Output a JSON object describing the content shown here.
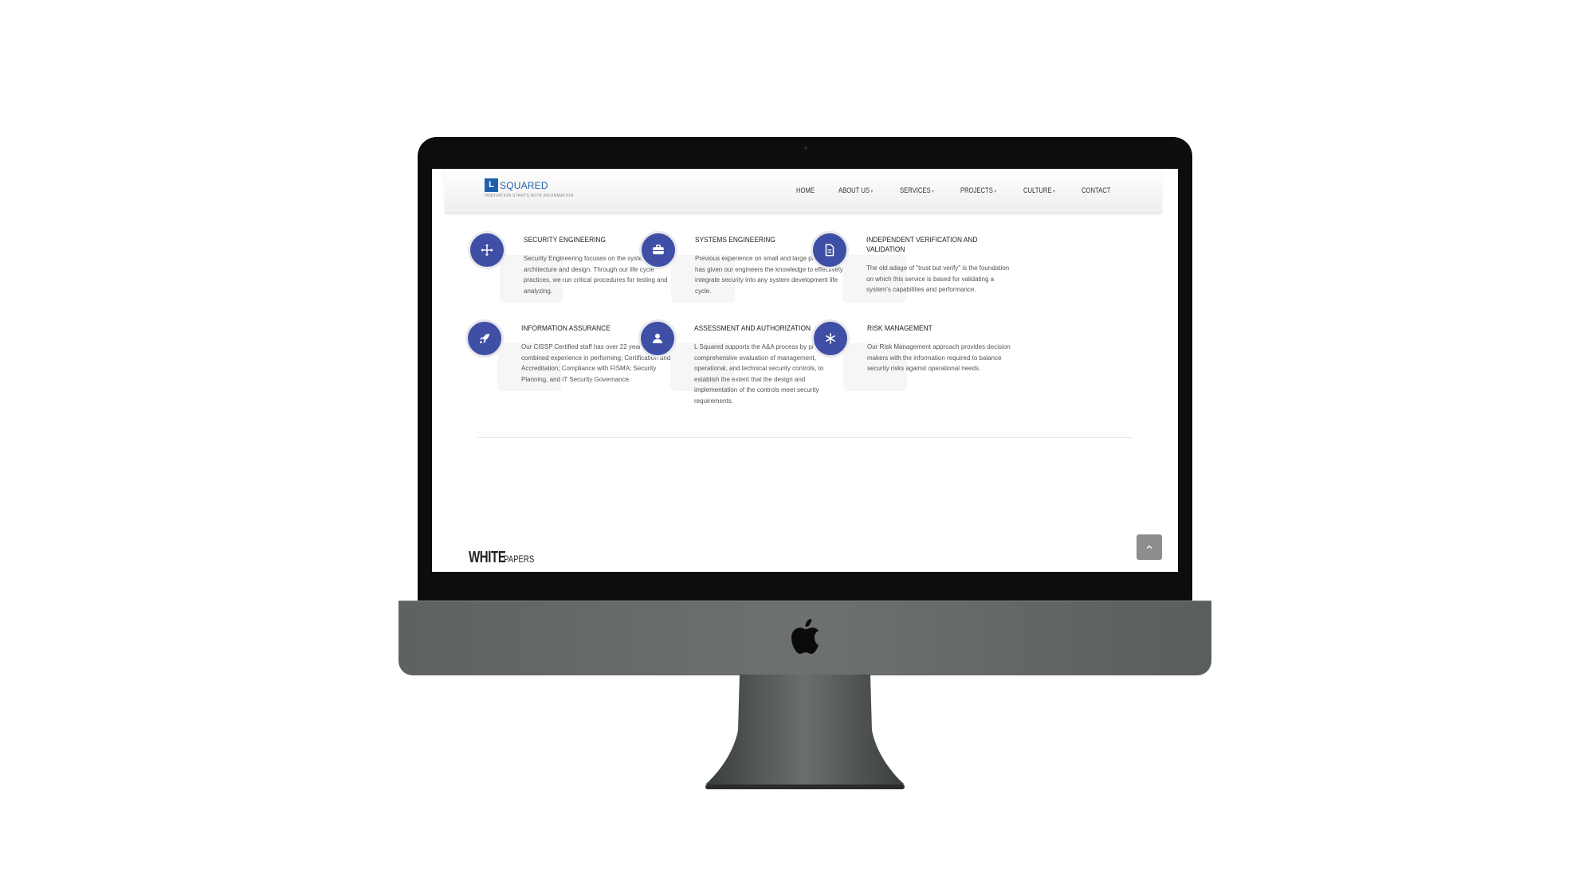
{
  "site": {
    "logo_letter": "L",
    "logo_name": "SQUARED",
    "logo_tagline": "INNOVATION STARTS WITH INFORMATION"
  },
  "nav": {
    "items": [
      {
        "label": "HOME",
        "dropdown": false
      },
      {
        "label": "ABOUT US",
        "dropdown": true
      },
      {
        "label": "SERVICES",
        "dropdown": true
      },
      {
        "label": "PROJECTS",
        "dropdown": true
      },
      {
        "label": "CULTURE",
        "dropdown": true
      },
      {
        "label": "CONTACT",
        "dropdown": false
      }
    ]
  },
  "services": [
    {
      "title": "SECURITY ENGINEERING",
      "icon": "move-arrows-icon",
      "text": "Security Engineering focuses on the system architecture and design. Through our life cycle practices, we run critical procedures for testing and analyzing."
    },
    {
      "title": "SYSTEMS ENGINEERING",
      "icon": "briefcase-icon",
      "text": "Previous experience on small and large programs has given our engineers the knowledge to effectively integrate security into any system development life cycle."
    },
    {
      "title": "INDEPENDENT VERIFICATION AND VALIDATION",
      "icon": "document-icon",
      "text": "The old adage of \"trust but verify\" is the foundation on which this service is based for validating a system's capabilities and performance."
    },
    {
      "title": "INFORMATION ASSURANCE",
      "icon": "rocket-icon",
      "text": "Our CISSP Certified staff has over 22 years of combined experience in performing; Certification and Accreditation; Compliance with FISMA; Security Planning, and IT Security Governance."
    },
    {
      "title": "ASSESSMENT AND AUTHORIZATION",
      "icon": "user-icon",
      "text": "L Squared supports the A&A process by providing comprehensive evaluation of management, operational, and technical security controls, to establish the extent that the design and implementation of the controls meet security requirements."
    },
    {
      "title": "RISK MANAGEMENT",
      "icon": "asterisk-icon",
      "text": "Our Risk Management approach provides decision makers with the information required to balance security risks against operational needs."
    }
  ],
  "section": {
    "heading_big": "WHITE",
    "heading_small": "PAPERS"
  },
  "colors": {
    "brand_blue": "#1f5fae",
    "icon_circle": "#3e4fa5",
    "scroll_button": "#8d8d8d"
  }
}
